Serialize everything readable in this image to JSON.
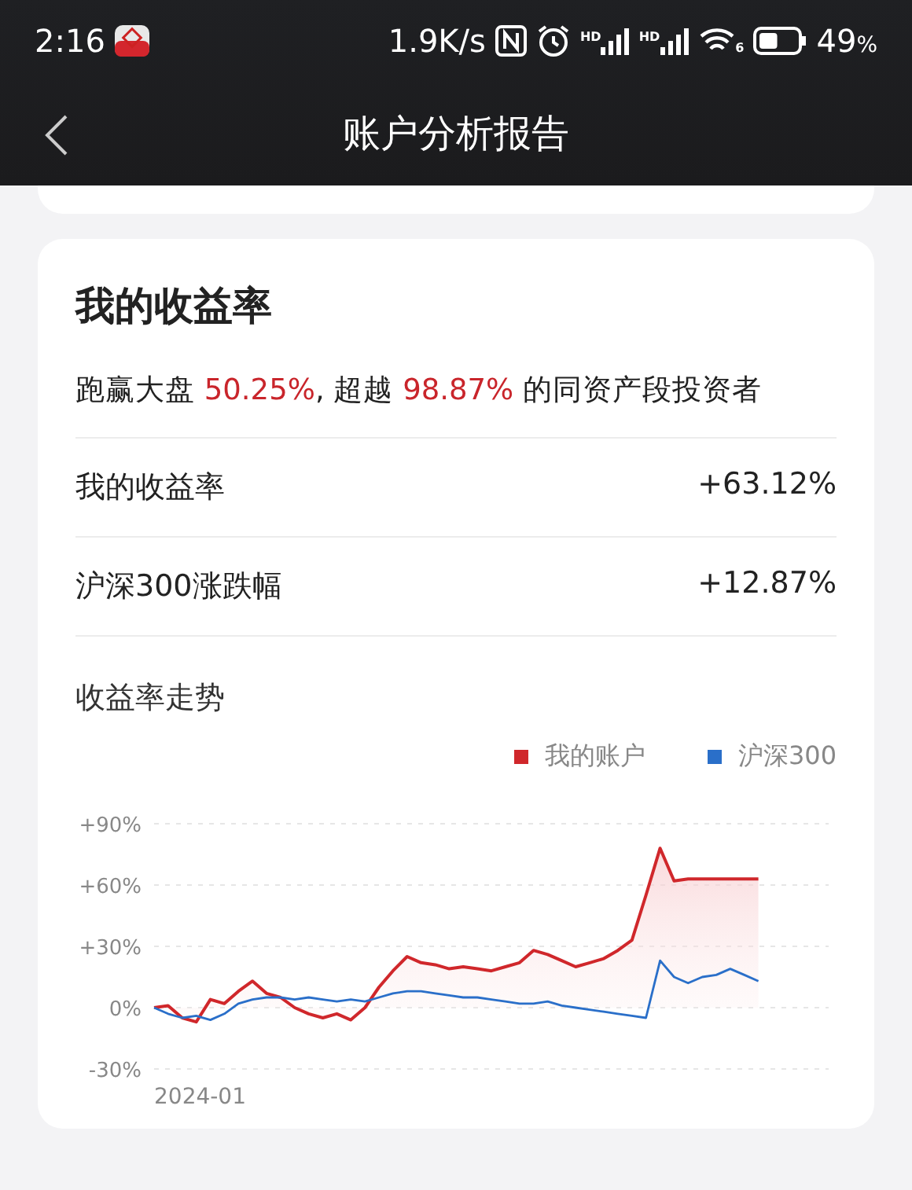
{
  "status_bar": {
    "time": "2:16",
    "speed": "1.9K/s",
    "signals": [
      {
        "label": "HD"
      },
      {
        "label": "HD"
      }
    ],
    "wifi_label": "6",
    "battery": "49",
    "battery_unit": "%"
  },
  "header": {
    "title": "账户分析报告"
  },
  "card": {
    "title": "我的收益率",
    "summary": [
      {
        "text": "跑赢大盘 ",
        "kind": "plain"
      },
      {
        "text": "50.25%",
        "kind": "highlight"
      },
      {
        "text": ", 超越 ",
        "kind": "plain"
      },
      {
        "text": "98.87%",
        "kind": "highlight"
      },
      {
        "text": " 的同资产段投资者",
        "kind": "plain"
      }
    ],
    "rows": [
      {
        "label": "我的收益率",
        "value": "+63.12%"
      },
      {
        "label": "沪深300涨跌幅",
        "value": "+12.87%"
      }
    ],
    "trend_title": "收益率走势",
    "start_label": "2024-01",
    "chart_data": {
      "type": "line",
      "grid": true,
      "ylim": [
        -30,
        90
      ],
      "yticks": [
        {
          "value": 90,
          "label": "+90%"
        },
        {
          "value": 60,
          "label": "+60%"
        },
        {
          "value": 30,
          "label": "+30%"
        },
        {
          "value": 0,
          "label": "0%"
        },
        {
          "value": -30,
          "label": "-30%"
        }
      ],
      "series": [
        {
          "name": "我的账户",
          "type": "area",
          "color": "#d0272b",
          "values": [
            0,
            1,
            -5,
            -7,
            4,
            2,
            8,
            13,
            7,
            5,
            0,
            -3,
            -5,
            -3,
            -6,
            0,
            10,
            18,
            25,
            22,
            21,
            19,
            20,
            19,
            18,
            20,
            22,
            28,
            26,
            23,
            20,
            22,
            24,
            28,
            33,
            55,
            78,
            62,
            63,
            63,
            63,
            63,
            63,
            63
          ]
        },
        {
          "name": "沪深300",
          "type": "line",
          "color": "#2a6fc9",
          "values": [
            0,
            -3,
            -5,
            -4,
            -6,
            -3,
            2,
            4,
            5,
            5,
            4,
            5,
            4,
            3,
            4,
            3,
            5,
            7,
            8,
            8,
            7,
            6,
            5,
            5,
            4,
            3,
            2,
            2,
            3,
            1,
            0,
            -1,
            -2,
            -3,
            -4,
            -5,
            23,
            15,
            12,
            15,
            16,
            19,
            16,
            13
          ]
        }
      ]
    }
  }
}
